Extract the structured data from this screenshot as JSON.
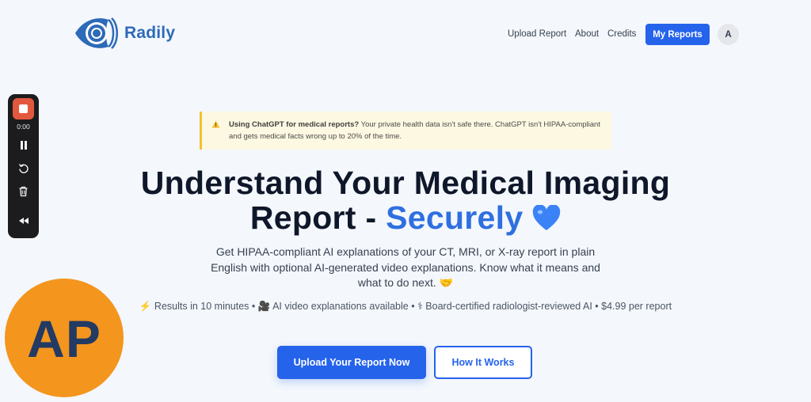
{
  "header": {
    "brand": "Radily",
    "nav": {
      "upload_report": "Upload Report",
      "about": "About",
      "credits": "Credits",
      "my_reports": "My Reports"
    },
    "user_initial": "A"
  },
  "recorder": {
    "time": "0:00",
    "icons": [
      "stop-icon",
      "pause-icon",
      "restart-icon",
      "trash-icon",
      "rewind-icon"
    ]
  },
  "overlay_avatar": {
    "initials": "AP",
    "color": "#f4951d"
  },
  "warning": {
    "title": "Using ChatGPT for medical reports?",
    "body": "Your private health data isn't safe there. ChatGPT isn't HIPAA-compliant and gets medical facts wrong up to 20% of the time."
  },
  "hero": {
    "title_line1": "Understand Your Medical Imaging",
    "title_line2": "Report - ",
    "title_accent": "Securely",
    "title_emoji": "blue-heart-icon",
    "subtitle": "Get HIPAA-compliant AI explanations of your CT, MRI, or X-ray report in plain English with optional AI-generated video explanations. Know what it means and what to do next. 🤝",
    "features": "⚡ Results in 10 minutes • 🎥 AI video explanations available • ⚕ Board-certified radiologist-reviewed AI • $4.99 per report"
  },
  "actions": {
    "primary": "Upload Your Report Now",
    "secondary": "How It Works"
  },
  "colors": {
    "brand": "#2d6ab8",
    "primary": "#2563eb",
    "accent_text": "#2f6fe0",
    "warning_bg": "#fdf8e1",
    "warning_border": "#f2c133"
  }
}
